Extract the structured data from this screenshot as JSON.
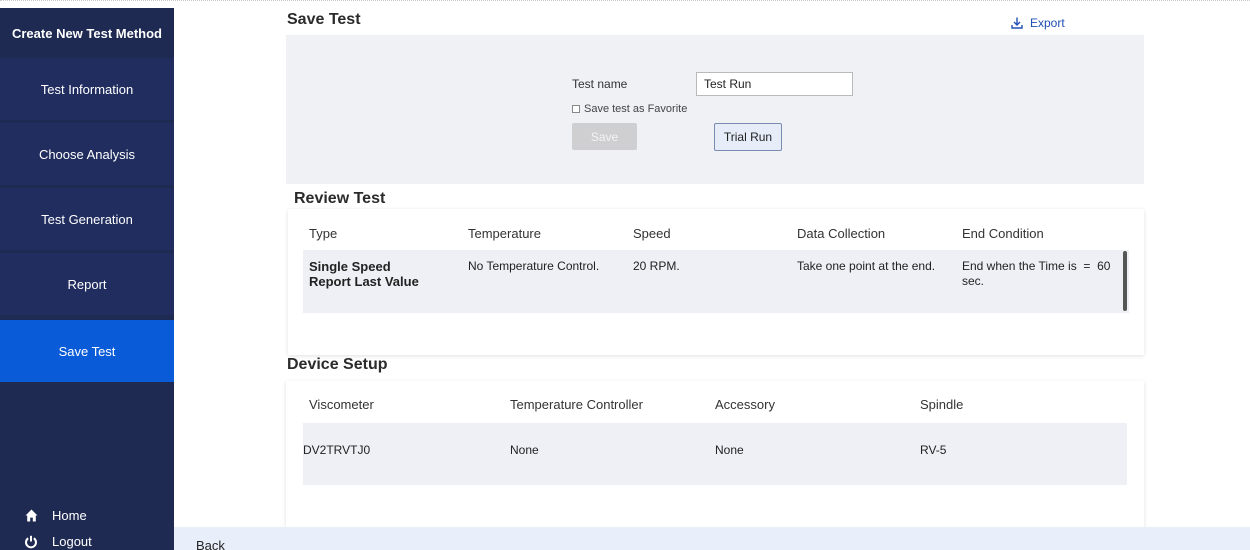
{
  "sidebar": {
    "title": "Create New Test Method",
    "items": [
      {
        "label": "Test Information"
      },
      {
        "label": "Choose Analysis"
      },
      {
        "label": "Test Generation"
      },
      {
        "label": "Report"
      },
      {
        "label": "Save Test",
        "active": true
      }
    ],
    "home": {
      "label": "Home",
      "icon": "home-icon"
    },
    "logout": {
      "label": "Logout",
      "icon": "power-icon"
    }
  },
  "footer": {
    "back_label": "Back"
  },
  "save_test": {
    "title": "Save Test",
    "export_label": "Export",
    "test_name_label": "Test name",
    "test_name_value": "Test Run",
    "favorite_label": "Save test as Favorite",
    "favorite_checked": false,
    "save_label": "Save",
    "trial_run_label": "Trial Run"
  },
  "review_test": {
    "title": "Review Test",
    "columns": [
      "Type",
      "Temperature",
      "Speed",
      "Data Collection",
      "End Condition"
    ],
    "row": {
      "type_line1": "Single Speed",
      "type_line2": "Report Last Value",
      "temperature": "No Temperature Control.",
      "speed": "20 RPM.",
      "data_collection": "Take one point at the end.",
      "end_condition_line1": "End when the Time is  =  60",
      "end_condition_line2": "sec."
    }
  },
  "device_setup": {
    "title": "Device Setup",
    "columns": [
      "Viscometer",
      "Temperature Controller",
      "Accessory",
      "Spindle"
    ],
    "row": {
      "viscometer": "DV2TRVTJ0",
      "temperature_controller": "None",
      "accessory": "None",
      "spindle": "RV-5"
    }
  },
  "colors": {
    "sidebar_bg": "#1e2a52",
    "sidebar_active": "#0a5bd8",
    "link": "#1f4fb5"
  }
}
